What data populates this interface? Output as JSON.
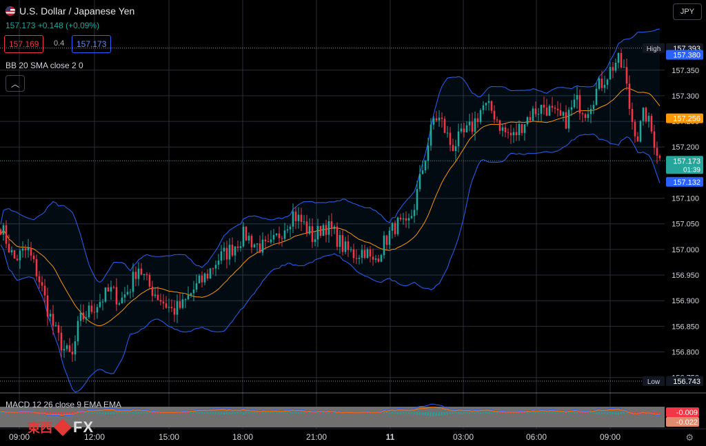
{
  "header": {
    "title": "U.S. Dollar / Japanese Yen",
    "last": "157.173",
    "change": "+0.148",
    "change_pct": "(+0.09%)",
    "sell": "157.169",
    "spread": "0.4",
    "buy": "157.173",
    "indicator": "BB 20 SMA close 2 0",
    "currency": "JPY",
    "macd_label": "MACD 12 26 close 9 EMA EMA"
  },
  "colors": {
    "up": "#26a69a",
    "down": "#f23645",
    "bb": "#2962ff",
    "sma": "#ff9800",
    "macd": "#2962ff",
    "signal": "#ff6d00"
  },
  "icons": [
    "us-flag-icon",
    "chevron-up-icon",
    "gear-icon"
  ],
  "watermark": {
    "cn": "東西",
    "fx": "FX"
  },
  "chart_data": {
    "type": "candlestick",
    "ylim": [
      156.72,
      157.46
    ],
    "y_ticks": [
      "157.350",
      "157.300",
      "157.250",
      "157.200",
      "157.100",
      "157.050",
      "157.000",
      "156.950",
      "156.900",
      "156.850",
      "156.800",
      "156.750"
    ],
    "x_ticks": [
      "09:00",
      "12:00",
      "15:00",
      "18:00",
      "21:00",
      "11",
      "03:00",
      "06:00",
      "09:00"
    ],
    "price_labels": [
      {
        "text": "High",
        "value": "157.393",
        "kind": "high"
      },
      {
        "text": "",
        "value": "157.380",
        "kind": "bb"
      },
      {
        "text": "",
        "value": "157.256",
        "kind": "sma"
      },
      {
        "text": "",
        "value": "157.173",
        "sub": "01:39",
        "kind": "last"
      },
      {
        "text": "",
        "value": "157.132",
        "kind": "bb"
      },
      {
        "text": "Low",
        "value": "156.743",
        "kind": "low"
      }
    ],
    "high": 157.393,
    "low": 156.743,
    "last": 157.173,
    "close_path": [
      [
        0,
        157.05
      ],
      [
        20,
        156.98
      ],
      [
        40,
        157.0
      ],
      [
        55,
        156.95
      ],
      [
        70,
        156.88
      ],
      [
        80,
        156.84
      ],
      [
        95,
        156.8
      ],
      [
        105,
        156.79
      ],
      [
        115,
        156.86
      ],
      [
        130,
        156.88
      ],
      [
        145,
        156.9
      ],
      [
        160,
        156.92
      ],
      [
        175,
        156.9
      ],
      [
        190,
        156.93
      ],
      [
        200,
        156.97
      ],
      [
        215,
        156.93
      ],
      [
        235,
        156.9
      ],
      [
        250,
        156.88
      ],
      [
        265,
        156.89
      ],
      [
        280,
        156.92
      ],
      [
        300,
        156.95
      ],
      [
        315,
        156.98
      ],
      [
        335,
        157.0
      ],
      [
        355,
        157.03
      ],
      [
        370,
        157.01
      ],
      [
        390,
        157.0
      ],
      [
        410,
        157.04
      ],
      [
        425,
        157.07
      ],
      [
        440,
        157.05
      ],
      [
        455,
        157.02
      ],
      [
        470,
        157.05
      ],
      [
        485,
        157.03
      ],
      [
        500,
        157.0
      ],
      [
        515,
        156.99
      ],
      [
        530,
        157.0
      ],
      [
        540,
        156.97
      ],
      [
        560,
        157.02
      ],
      [
        575,
        157.05
      ],
      [
        590,
        157.04
      ],
      [
        600,
        157.08
      ],
      [
        610,
        157.14
      ],
      [
        620,
        157.2
      ],
      [
        630,
        157.26
      ],
      [
        640,
        157.25
      ],
      [
        655,
        157.2
      ],
      [
        670,
        157.22
      ],
      [
        685,
        157.24
      ],
      [
        700,
        157.28
      ],
      [
        715,
        157.27
      ],
      [
        730,
        157.23
      ],
      [
        745,
        157.22
      ],
      [
        760,
        157.25
      ],
      [
        775,
        157.27
      ],
      [
        790,
        157.28
      ],
      [
        805,
        157.26
      ],
      [
        820,
        157.25
      ],
      [
        835,
        157.29
      ],
      [
        850,
        157.27
      ],
      [
        865,
        157.31
      ],
      [
        880,
        157.34
      ],
      [
        895,
        157.37
      ],
      [
        905,
        157.35
      ],
      [
        915,
        157.26
      ],
      [
        925,
        157.22
      ],
      [
        935,
        157.27
      ],
      [
        945,
        157.23
      ],
      [
        958,
        157.17
      ]
    ],
    "macd": {
      "macd": -0.009,
      "signal": -0.022
    }
  }
}
